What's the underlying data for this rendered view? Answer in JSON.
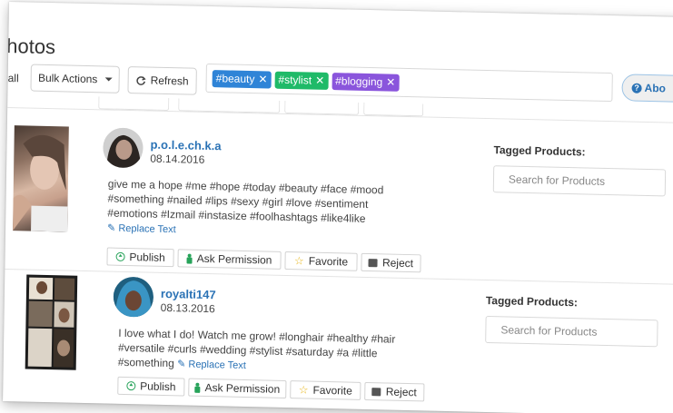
{
  "page": {
    "title": "hotos",
    "select_all_label": "all"
  },
  "toolbar": {
    "bulk_actions_label": "Bulk Actions",
    "refresh_label": "Refresh",
    "about_label": "Abo"
  },
  "tag_filter": {
    "tags": [
      {
        "label": "#beauty",
        "color": "#2f84d7"
      },
      {
        "label": "#stylist",
        "color": "#1fba68"
      },
      {
        "label": "#blogging",
        "color": "#8a55dc"
      }
    ]
  },
  "posts": [
    {
      "username": "p.o.l.e.ch.k.a",
      "date": "08.14.2016",
      "caption": [
        "give me a hope #me #hope #today #beauty #face #mood",
        "#something #nailed #lips #sexy #girl #love #sentiment",
        "#emotions #Izmail #instasize #foolhashtags #like4like"
      ],
      "replace_text_label": "Replace Text",
      "tagged_products_label": "Tagged Products:",
      "search_placeholder": "Search for Products",
      "actions": {
        "publish": "Publish",
        "ask_permission": "Ask Permission",
        "favorite": "Favorite",
        "reject": "Reject"
      }
    },
    {
      "username": "royalti147",
      "date": "08.13.2016",
      "caption": [
        "I love what I do! Watch me grow! #longhair #healthy #hair",
        "#versatile #curls #wedding #stylist #saturday #a #little",
        "#something"
      ],
      "replace_text_label": "Replace Text",
      "tagged_products_label": "Tagged Products:",
      "search_placeholder": "Search for Products",
      "actions": {
        "publish": "Publish",
        "ask_permission": "Ask Permission",
        "favorite": "Favorite",
        "reject": "Reject"
      }
    }
  ]
}
